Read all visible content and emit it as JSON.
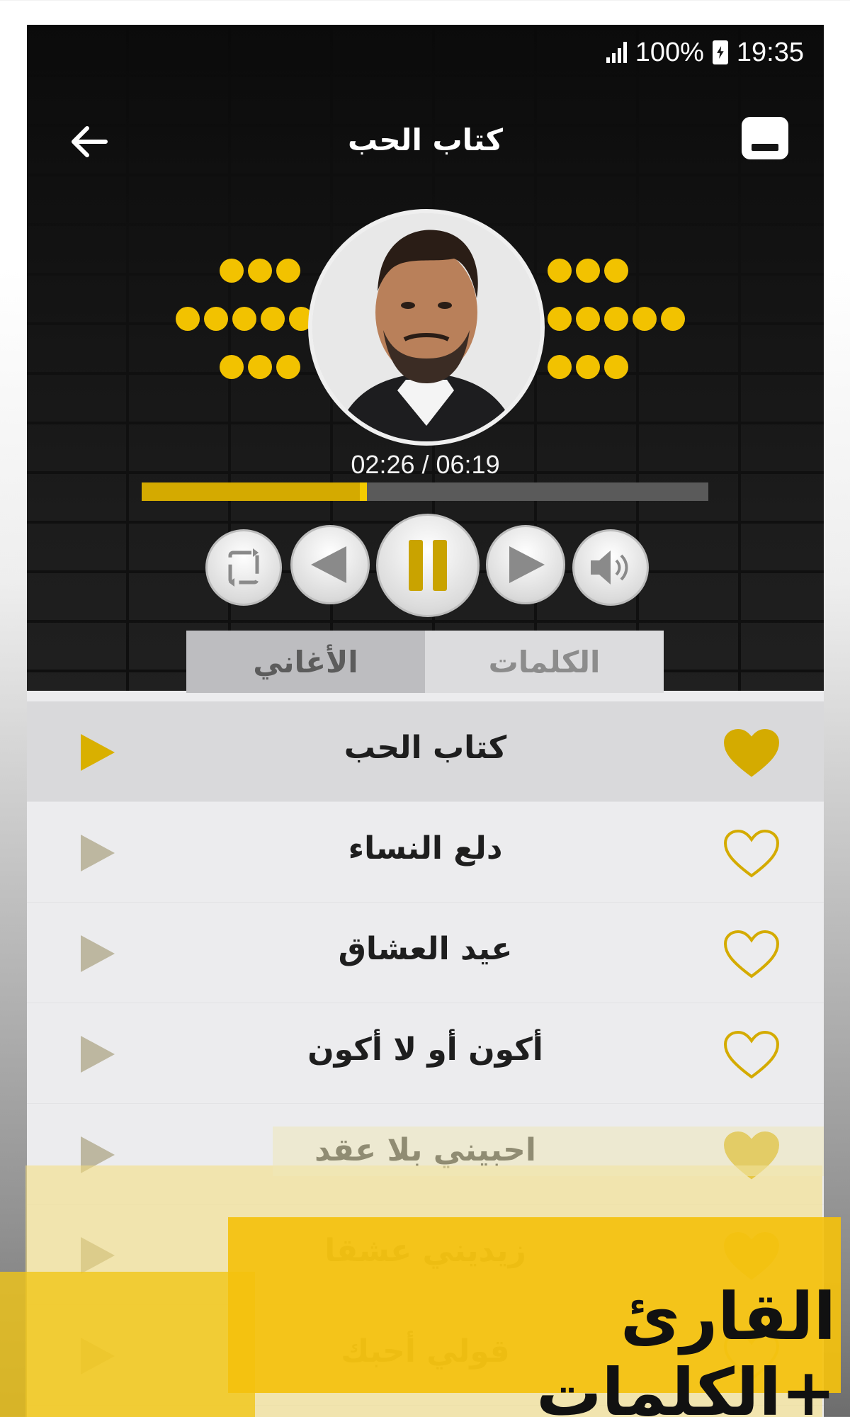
{
  "status_bar": {
    "battery": "100%",
    "time": "19:35"
  },
  "header": {
    "title": "كتاب الحب"
  },
  "player": {
    "elapsed": "02:26",
    "duration": "06:19",
    "time_display": "02:26 / 06:19",
    "progress": 0.39
  },
  "controls": [
    {
      "name": "repeat-icon"
    },
    {
      "name": "previous-icon"
    },
    {
      "name": "pause-icon"
    },
    {
      "name": "next-icon"
    },
    {
      "name": "volume-icon"
    }
  ],
  "tabs": [
    {
      "label": "الأغاني",
      "active": true
    },
    {
      "label": "الكلمات",
      "active": false
    }
  ],
  "songs": [
    {
      "title": "كتاب الحب",
      "favorite": true,
      "current": true
    },
    {
      "title": "دلع النساء",
      "favorite": false,
      "current": false
    },
    {
      "title": "عيد العشاق",
      "favorite": false,
      "current": false
    },
    {
      "title": "أكون أو لا أكون",
      "favorite": false,
      "current": false
    },
    {
      "title": "احبيني بلا عقد",
      "favorite": true,
      "current": false
    },
    {
      "title": "زيديني عشقا",
      "favorite": true,
      "current": false
    },
    {
      "title": "قولي أحبك",
      "favorite": false,
      "current": false
    }
  ],
  "promo": {
    "text": "القارئ +الكلمات"
  },
  "colors": {
    "accent": "#f2c200",
    "dark": "#151515",
    "list_bg": "#ececee"
  }
}
